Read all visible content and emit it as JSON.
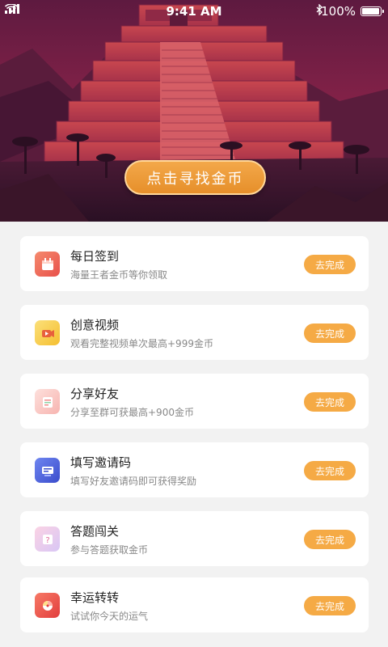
{
  "status_bar": {
    "time": "9:41 AM",
    "battery_text": "100%",
    "battery_level": 1.0,
    "icons": [
      "signal-icon",
      "wifi-icon",
      "bluetooth-icon",
      "battery-icon"
    ]
  },
  "hero": {
    "button_label": "点击寻找金币",
    "colors": {
      "sky": "#7d2048",
      "pyramid": "#c2444f",
      "button": "#ec982f"
    }
  },
  "tasks": [
    {
      "title": "每日签到",
      "desc": "海量王者金币等你领取",
      "button": "去完成",
      "icon": "calendar-icon",
      "icon_color": "#f06a5a"
    },
    {
      "title": "创意视频",
      "desc": "观看完整视频单次最高+999金币",
      "button": "去完成",
      "icon": "video-icon",
      "icon_color": "#f7c948"
    },
    {
      "title": "分享好友",
      "desc": "分享至群可获最高+900金币",
      "button": "去完成",
      "icon": "share-icon",
      "icon_color": "#f6a5a5"
    },
    {
      "title": "填写邀请码",
      "desc": "填写好友邀请码即可获得奖励",
      "button": "去完成",
      "icon": "invite-code-icon",
      "icon_color": "#4a5fd8"
    },
    {
      "title": "答题闯关",
      "desc": "参与答题获取金币",
      "button": "去完成",
      "icon": "quiz-icon",
      "icon_color": "#f4a6c4"
    },
    {
      "title": "幸运转转",
      "desc": "试试你今天的运气",
      "button": "去完成",
      "icon": "lucky-wheel-icon",
      "icon_color": "#ef5a4a"
    }
  ]
}
